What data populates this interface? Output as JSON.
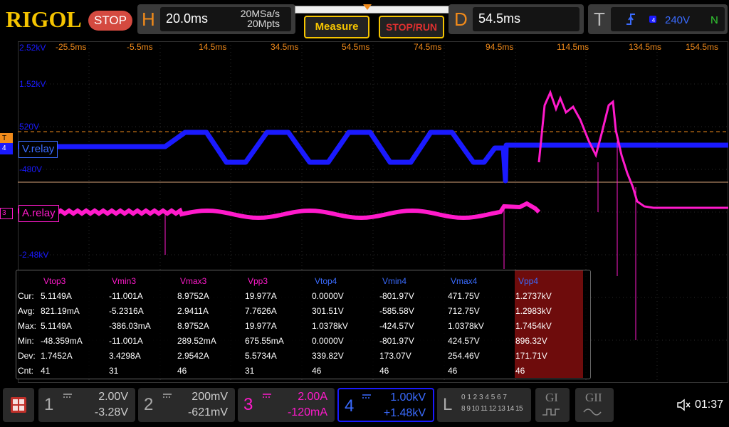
{
  "brand": "RIGOL",
  "status": "STOP",
  "horizontal": {
    "letter": "H",
    "timebase": "20.0ms",
    "sample_rate": "20MSa/s",
    "memory": "20Mpts"
  },
  "buttons": {
    "measure": "Measure",
    "stop_run": "STOP/RUN"
  },
  "delay": {
    "letter": "D",
    "value": "54.5ms"
  },
  "trigger": {
    "letter": "T",
    "level": "240V",
    "mode": "N"
  },
  "time_labels": [
    "-25.5ms",
    "-5.5ms",
    "14.5ms",
    "34.5ms",
    "54.5ms",
    "74.5ms",
    "94.5ms",
    "114.5ms",
    "134.5ms",
    "154.5ms"
  ],
  "volt_labels": [
    "2.52kV",
    "1.52kV",
    "520V",
    "-480V",
    "-2.48kV"
  ],
  "channels": {
    "ch4_label": "V.relay",
    "ch4_marker": "4",
    "ch3_label": "A.relay",
    "ch3_marker": "3",
    "trigger_marker": "T"
  },
  "measure": {
    "headers": [
      "Vtop3",
      "Vmin3",
      "Vmax3",
      "Vpp3",
      "Vtop4",
      "Vmin4",
      "Vmax4",
      "Vpp4"
    ],
    "rows": [
      {
        "label": "Cur:",
        "values": [
          "5.1149A",
          "-11.001A",
          "8.9752A",
          "19.977A",
          "0.0000V",
          "-801.97V",
          "471.75V",
          "1.2737kV"
        ]
      },
      {
        "label": "Avg:",
        "values": [
          "821.19mA",
          "-5.2316A",
          "2.9411A",
          "7.7626A",
          "301.51V",
          "-585.58V",
          "712.75V",
          "1.2983kV"
        ]
      },
      {
        "label": "Max:",
        "values": [
          "5.1149A",
          "-386.03mA",
          "8.9752A",
          "19.977A",
          "1.0378kV",
          "-424.57V",
          "1.0378kV",
          "1.7454kV"
        ]
      },
      {
        "label": "Min:",
        "values": [
          "-48.359mA",
          "-11.001A",
          "289.52mA",
          "675.55mA",
          "0.0000V",
          "-801.97V",
          "424.57V",
          "896.32V"
        ]
      },
      {
        "label": "Dev:",
        "values": [
          "1.7452A",
          "3.4298A",
          "2.9542A",
          "5.5734A",
          "339.82V",
          "173.07V",
          "254.46V",
          "171.71V"
        ]
      },
      {
        "label": "Cnt:",
        "values": [
          "41",
          "31",
          "46",
          "31",
          "46",
          "46",
          "46",
          "46"
        ]
      }
    ]
  },
  "bottom": {
    "ch1": {
      "num": "1",
      "scale": "2.00V",
      "offset": "-3.28V"
    },
    "ch2": {
      "num": "2",
      "scale": "200mV",
      "offset": "-621mV"
    },
    "ch3": {
      "num": "3",
      "scale": "2.00A",
      "offset": "-120mA"
    },
    "ch4": {
      "num": "4",
      "scale": "1.00kV",
      "offset": "+1.48kV"
    },
    "logic": {
      "letter": "L",
      "row1": "0 1 2 3  4 5 6 7",
      "row2": "8 9 10 11 12 13 14 15"
    },
    "g1": "GI",
    "g2": "GII",
    "time": "01:37"
  },
  "colors": {
    "ch1": "#f5e400",
    "ch3": "#ff1acb",
    "ch4": "#1a1aff",
    "ch4_text": "#3a6bff",
    "orange": "#f08a1a",
    "measure_hi": "#6e0c0c"
  }
}
